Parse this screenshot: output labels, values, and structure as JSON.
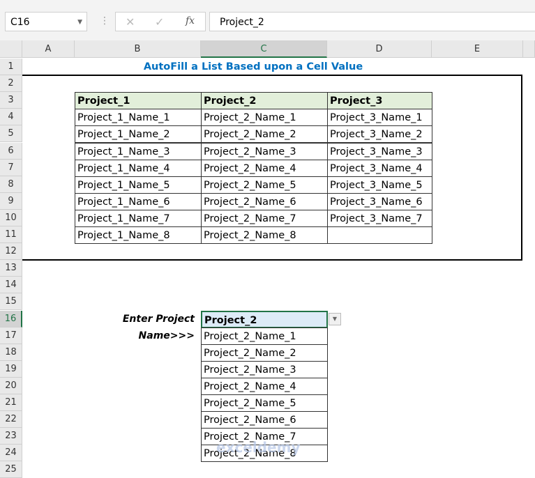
{
  "name_box": "C16",
  "formula_bar": "Project_2",
  "formula_icons": [
    "cancel-icon",
    "enter-icon",
    "fx-icon"
  ],
  "columns": [
    "A",
    "B",
    "C",
    "D",
    "E"
  ],
  "selected_column": "C",
  "rows": [
    "1",
    "2",
    "3",
    "4",
    "5",
    "6",
    "7",
    "8",
    "9",
    "10",
    "11",
    "12",
    "13",
    "14",
    "15",
    "16",
    "17",
    "18",
    "19",
    "20",
    "21",
    "22",
    "23",
    "24",
    "25"
  ],
  "selected_row": "16",
  "title": "AutoFill a List Based upon a Cell Value",
  "table": {
    "headers": [
      "Project_1",
      "Project_2",
      "Project_3"
    ],
    "columns": [
      [
        "Project_1_Name_1",
        "Project_1_Name_2",
        "Project_1_Name_3",
        "Project_1_Name_4",
        "Project_1_Name_5",
        "Project_1_Name_6",
        "Project_1_Name_7",
        "Project_1_Name_8"
      ],
      [
        "Project_2_Name_1",
        "Project_2_Name_2",
        "Project_2_Name_3",
        "Project_2_Name_4",
        "Project_2_Name_5",
        "Project_2_Name_6",
        "Project_2_Name_7",
        "Project_2_Name_8"
      ],
      [
        "Project_3_Name_1",
        "Project_3_Name_2",
        "Project_3_Name_3",
        "Project_3_Name_4",
        "Project_3_Name_5",
        "Project_3_Name_6",
        "Project_3_Name_7",
        ""
      ]
    ]
  },
  "input_label": "Enter Project Name>>>",
  "input_value": "Project_2",
  "result_list": [
    "Project_2_Name_1",
    "Project_2_Name_2",
    "Project_2_Name_3",
    "Project_2_Name_4",
    "Project_2_Name_5",
    "Project_2_Name_6",
    "Project_2_Name_7",
    "Project_2_Name_8"
  ],
  "watermark": "exceldemy",
  "colors": {
    "title": "#0070c0",
    "header_fill": "#e2efda",
    "selected_fill": "#ddebf7",
    "accent": "#217346"
  }
}
